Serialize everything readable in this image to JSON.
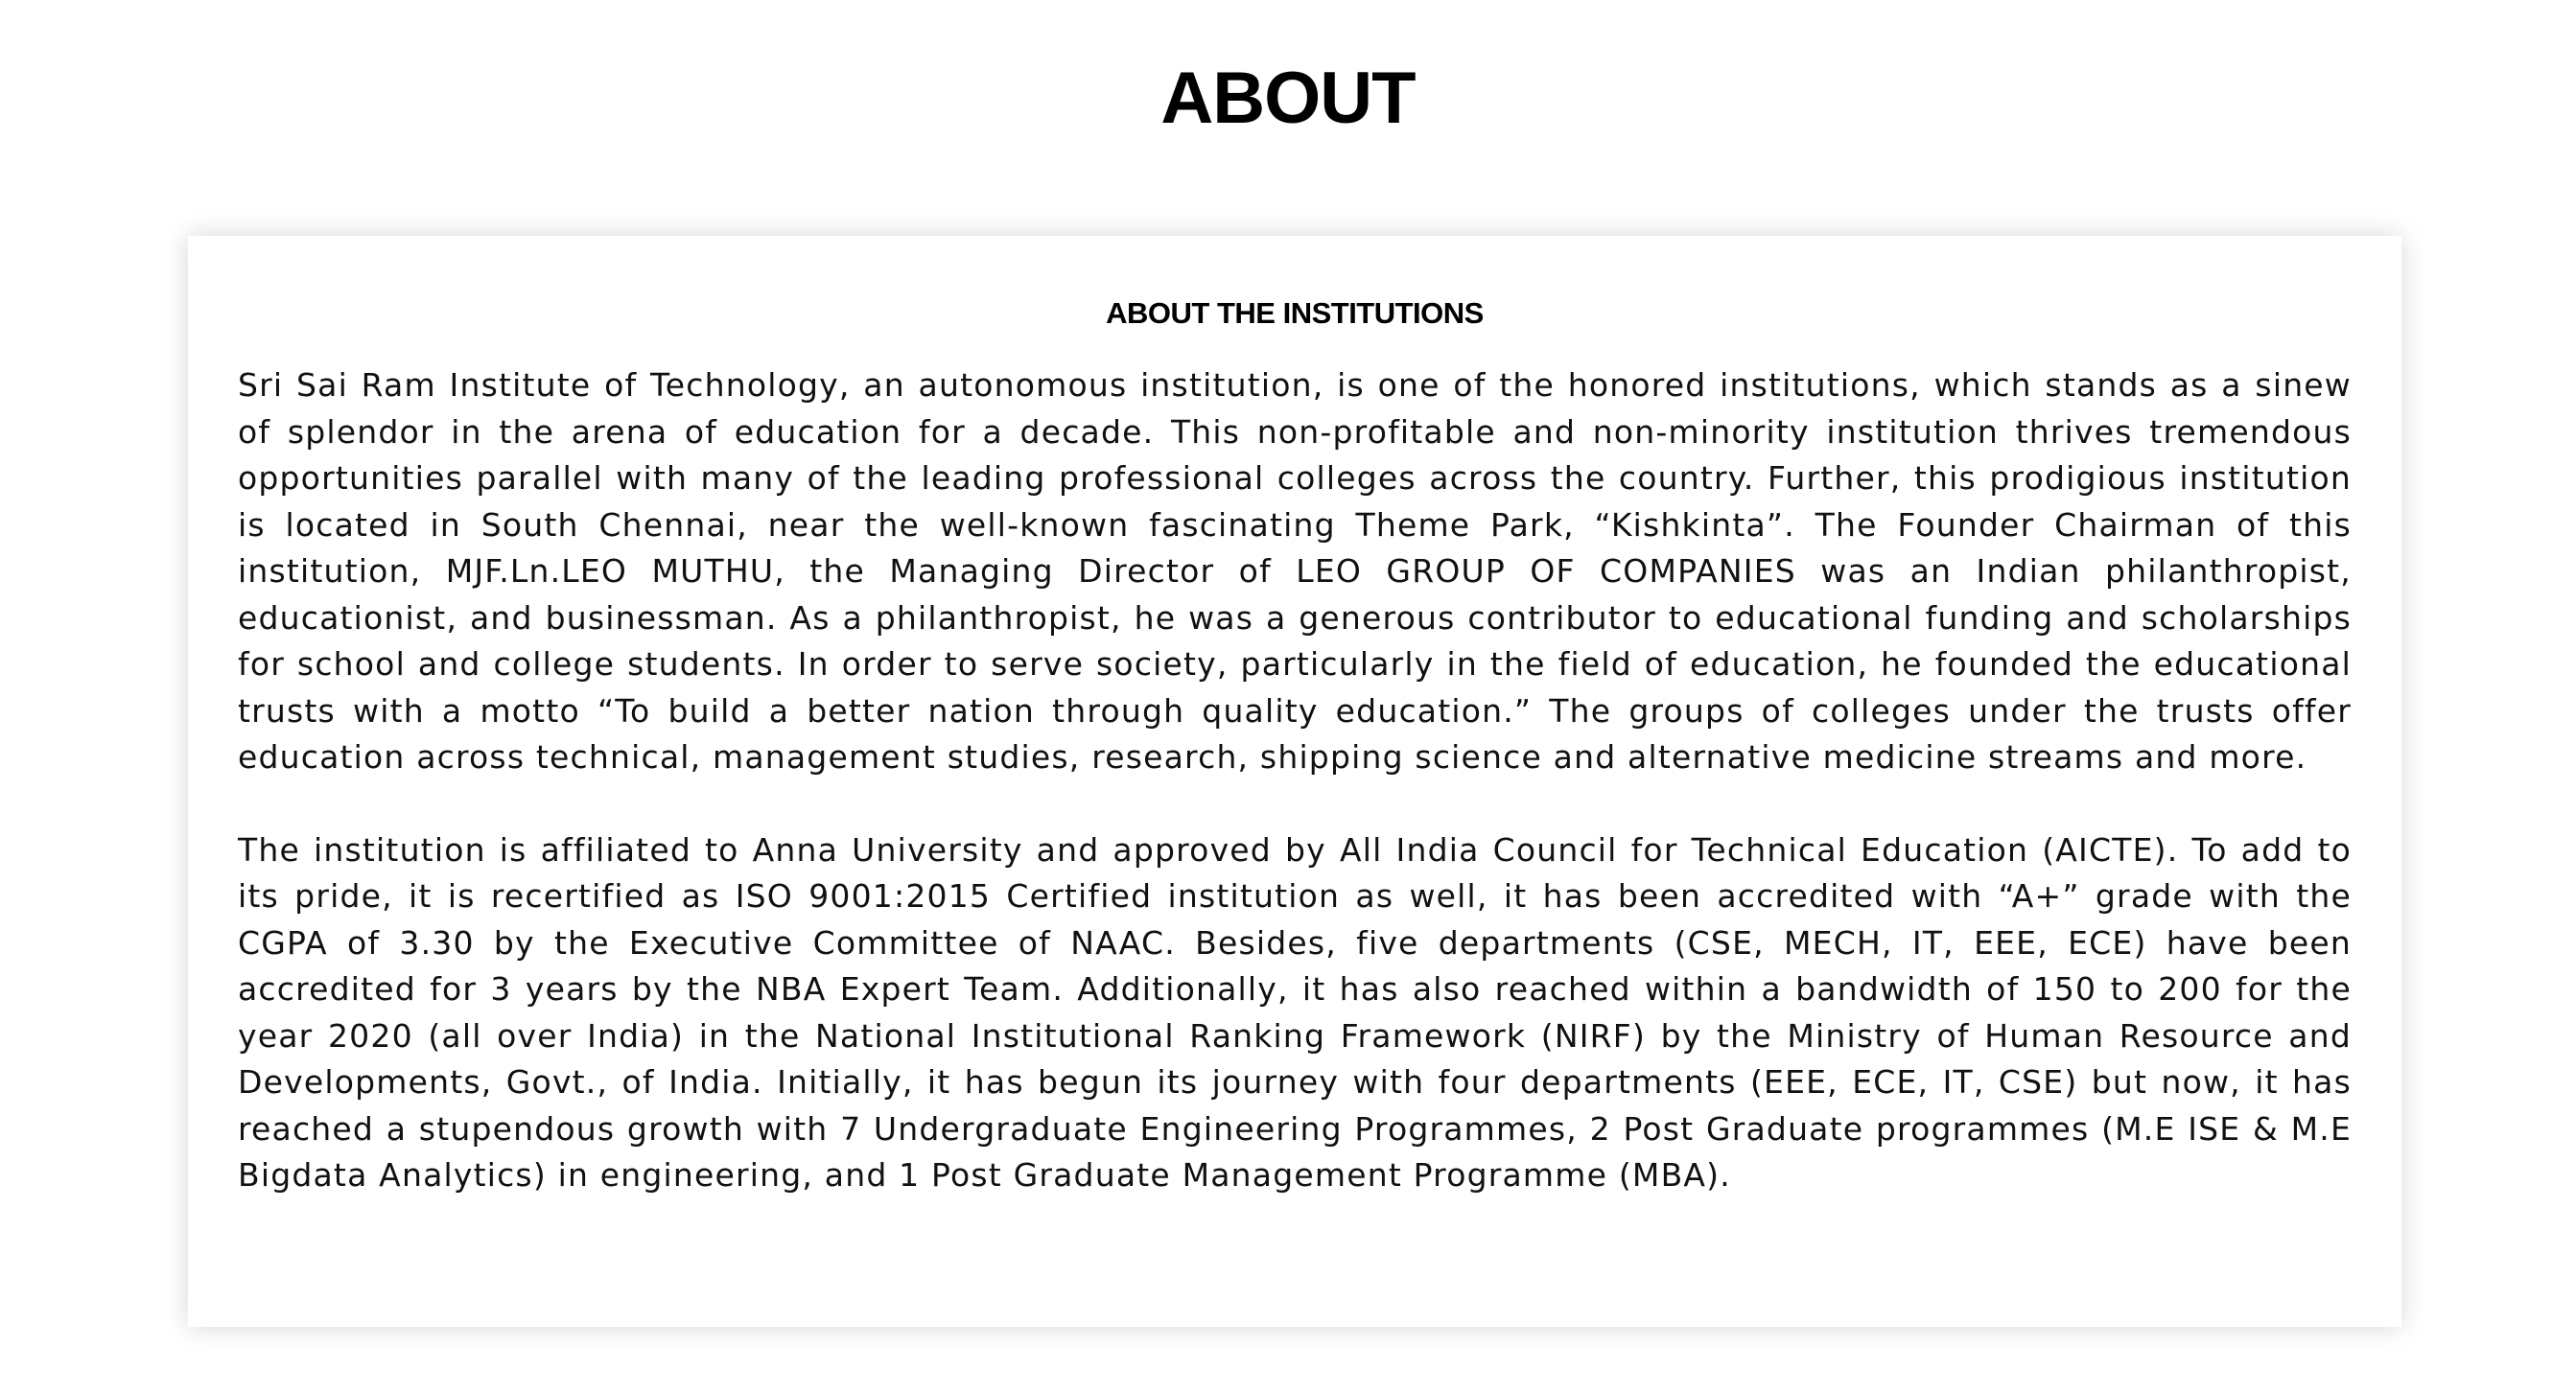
{
  "page": {
    "title": "ABOUT"
  },
  "about_card": {
    "heading": "ABOUT THE INSTITUTIONS",
    "paragraphs": [
      "Sri Sai Ram Institute of Technology, an autonomous institution, is one of the honored institutions, which stands as a sinew of splendor in the arena of education for a decade. This non-profitable and non-minority institution thrives tremendous opportunities parallel with many of the leading professional colleges across the country. Further, this prodigious institution is located in South Chennai, near the well-known fascinating Theme Park, “Kishkinta”. The Founder Chairman of this institution, MJF.Ln.LEO MUTHU, the Managing Director of LEO GROUP OF COMPANIES was an Indian philanthropist, educationist, and businessman. As a philanthropist, he was a generous contributor to educational funding and scholarships for school and college students. In order to serve society, particularly in the field of education, he founded the educational trusts with a motto “To build a better nation through quality education.” The groups of colleges under the trusts offer education across technical, management studies, research, shipping science and alternative medicine streams and more.",
      "The institution is affiliated to Anna University and approved by All India Council for Technical Education (AICTE). To add to its pride, it is recertified as ISO 9001:2015 Certified institution as well, it has been accredited with “A+” grade with the CGPA of 3.30 by the Executive Committee of NAAC. Besides, five departments (CSE, MECH, IT, EEE, ECE) have been accredited for 3 years by the NBA Expert Team. Additionally, it has also reached within a bandwidth of 150 to 200 for the year 2020 (all over India) in the National Institutional Ranking Framework (NIRF) by the Ministry of Human Resource and Developments, Govt., of India. Initially, it has begun its journey with four departments (EEE, ECE, IT, CSE) but now, it has reached a stupendous growth with 7 Undergraduate Engineering Programmes, 2 Post Graduate programmes (M.E ISE & M.E Bigdata Analytics) in engineering, and 1 Post Graduate Management Programme (MBA)."
    ]
  }
}
